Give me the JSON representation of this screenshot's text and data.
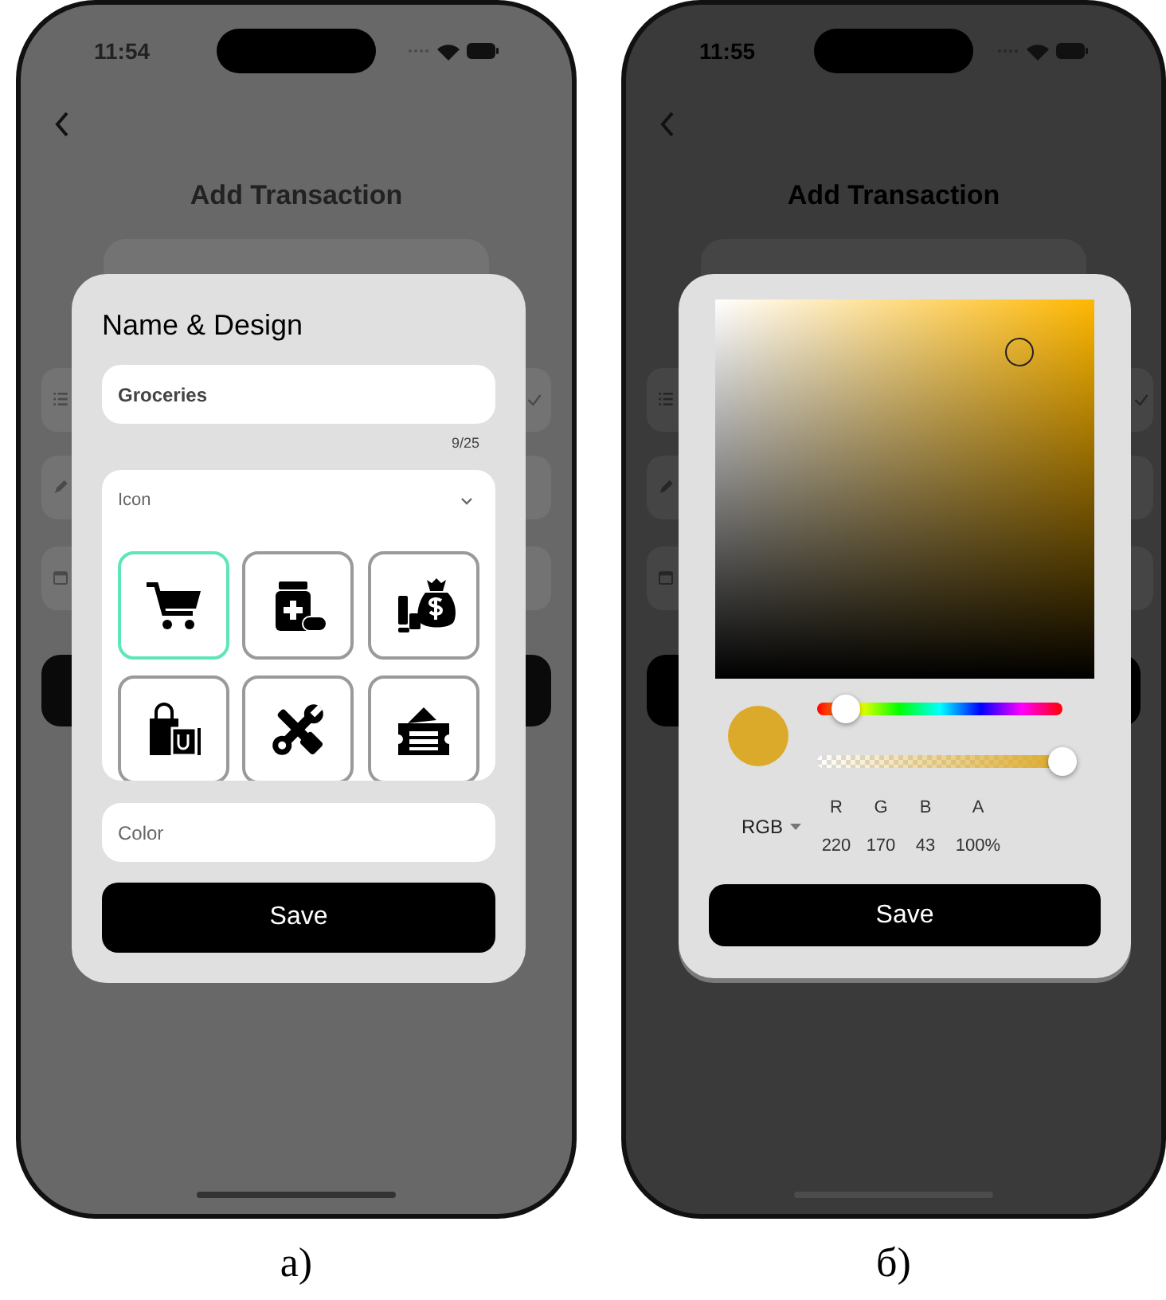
{
  "panels": [
    {
      "kind": "name-design",
      "caption": "а)",
      "time": "11:54",
      "screen_title": "Add Transaction",
      "dialog": {
        "title": "Name & Design",
        "name_field": {
          "value": "Groceries",
          "counter": "9/25"
        },
        "icon_section": {
          "label": "Icon",
          "icons": [
            {
              "selected": true
            },
            {
              "selected": false
            },
            {
              "selected": false
            },
            {
              "selected": false
            },
            {
              "selected": false
            },
            {
              "selected": false
            }
          ]
        },
        "color_field": {
          "placeholder": "Color"
        },
        "save_button": "Save"
      }
    },
    {
      "kind": "color-picker",
      "caption": "б)",
      "time": "11:55",
      "screen_title": "Add Transaction",
      "picker": {
        "hue": {
          "level": 0.12
        },
        "alpha": {
          "level": 1
        },
        "mode": "RGB",
        "channels": [
          {
            "label": "R",
            "value": "220"
          },
          {
            "label": "G",
            "value": "170"
          },
          {
            "label": "B",
            "value": "43"
          },
          {
            "label": "A",
            "value": "100%"
          }
        ],
        "save_button": "Save"
      }
    }
  ]
}
